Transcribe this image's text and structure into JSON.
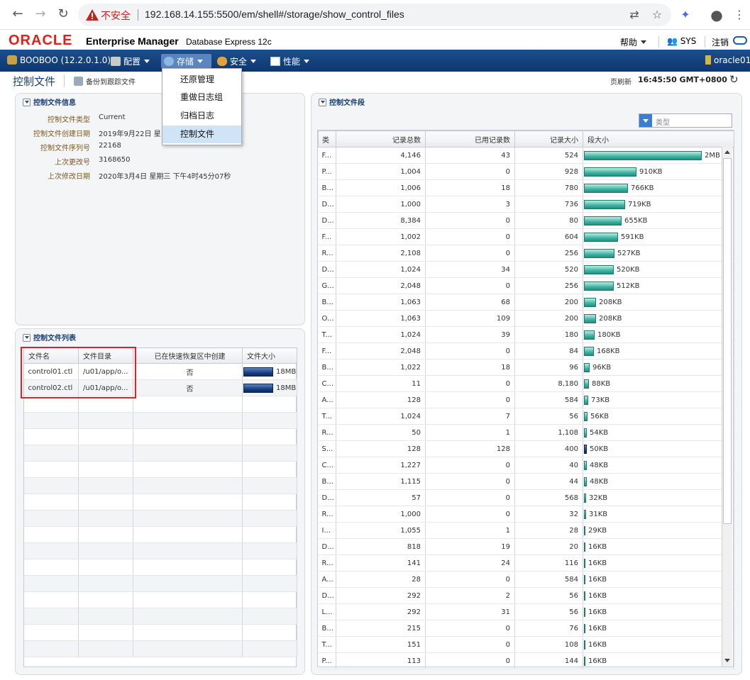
{
  "browser": {
    "not_secure": "不安全",
    "url": "192.168.14.155:5500/em/shell#/storage/show_control_files"
  },
  "header": {
    "logo": "ORACLE",
    "product": "Enterprise Manager",
    "edition": "Database Express 12c",
    "help": "帮助",
    "user": "SYS",
    "logout": "注销"
  },
  "nav": {
    "db": "BOOBOO (12.2.0.1.0)",
    "config": "配置",
    "storage": "存储",
    "security": "安全",
    "performance": "性能",
    "host": "oracle01"
  },
  "storage_menu": [
    "还原管理",
    "重做日志组",
    "归档日志",
    "控制文件"
  ],
  "page": {
    "title": "控制文件",
    "backup_trace": "备份到跟踪文件",
    "refresh_label": "页刷新",
    "refresh_time": "16:45:50 GMT+0800"
  },
  "info_panel": {
    "title": "控制文件信息",
    "rows": [
      {
        "label": "控制文件类型",
        "value": "Current"
      },
      {
        "label": "控制文件创建日期",
        "value": "2019年9月22日 星"
      },
      {
        "label": "控制文件序列号",
        "value": "22168"
      },
      {
        "label": "上次更改号",
        "value": "3168650"
      },
      {
        "label": "上次修改日期",
        "value": "2020年3月4日 星期三 下午4时45分07秒"
      }
    ]
  },
  "files_panel": {
    "title": "控制文件列表",
    "columns": [
      "文件名",
      "文件目录",
      "已在快速恢复区中创建",
      "文件大小"
    ],
    "rows": [
      {
        "name": "control01.ctl",
        "dir": "/u01/app/o...",
        "fra": "否",
        "size": "18MB"
      },
      {
        "name": "control02.ctl",
        "dir": "/u01/app/o...",
        "fra": "否",
        "size": "18MB"
      }
    ]
  },
  "sections_panel": {
    "title": "控制文件段",
    "filter_placeholder": "类型",
    "columns": [
      "类",
      "记录总数",
      "已用记录数",
      "记录大小",
      "段大小"
    ],
    "rows": [
      {
        "type": "F...",
        "total": "4,146",
        "used": "43",
        "size": "524",
        "seg": "2MB",
        "kb": 2048
      },
      {
        "type": "P...",
        "total": "1,004",
        "used": "0",
        "size": "928",
        "seg": "910KB",
        "kb": 910
      },
      {
        "type": "B...",
        "total": "1,006",
        "used": "18",
        "size": "780",
        "seg": "766KB",
        "kb": 766
      },
      {
        "type": "D...",
        "total": "1,000",
        "used": "3",
        "size": "736",
        "seg": "719KB",
        "kb": 719
      },
      {
        "type": "D...",
        "total": "8,384",
        "used": "0",
        "size": "80",
        "seg": "655KB",
        "kb": 655
      },
      {
        "type": "F...",
        "total": "1,002",
        "used": "0",
        "size": "604",
        "seg": "591KB",
        "kb": 591
      },
      {
        "type": "R...",
        "total": "2,108",
        "used": "0",
        "size": "256",
        "seg": "527KB",
        "kb": 527
      },
      {
        "type": "D...",
        "total": "1,024",
        "used": "34",
        "size": "520",
        "seg": "520KB",
        "kb": 520
      },
      {
        "type": "G...",
        "total": "2,048",
        "used": "0",
        "size": "256",
        "seg": "512KB",
        "kb": 512
      },
      {
        "type": "B...",
        "total": "1,063",
        "used": "68",
        "size": "200",
        "seg": "208KB",
        "kb": 208
      },
      {
        "type": "O...",
        "total": "1,063",
        "used": "109",
        "size": "200",
        "seg": "208KB",
        "kb": 208
      },
      {
        "type": "T...",
        "total": "1,024",
        "used": "39",
        "size": "180",
        "seg": "180KB",
        "kb": 180
      },
      {
        "type": "F...",
        "total": "2,048",
        "used": "0",
        "size": "84",
        "seg": "168KB",
        "kb": 168
      },
      {
        "type": "B...",
        "total": "1,022",
        "used": "18",
        "size": "96",
        "seg": "96KB",
        "kb": 96
      },
      {
        "type": "C...",
        "total": "11",
        "used": "0",
        "size": "8,180",
        "seg": "88KB",
        "kb": 88
      },
      {
        "type": "A...",
        "total": "128",
        "used": "0",
        "size": "584",
        "seg": "73KB",
        "kb": 73
      },
      {
        "type": "T...",
        "total": "1,024",
        "used": "7",
        "size": "56",
        "seg": "56KB",
        "kb": 56
      },
      {
        "type": "R...",
        "total": "50",
        "used": "1",
        "size": "1,108",
        "seg": "54KB",
        "kb": 54
      },
      {
        "type": "S...",
        "total": "128",
        "used": "128",
        "size": "400",
        "seg": "50KB",
        "kb": 50,
        "full": true
      },
      {
        "type": "C...",
        "total": "1,227",
        "used": "0",
        "size": "40",
        "seg": "48KB",
        "kb": 48
      },
      {
        "type": "B...",
        "total": "1,115",
        "used": "0",
        "size": "44",
        "seg": "48KB",
        "kb": 48
      },
      {
        "type": "D...",
        "total": "57",
        "used": "0",
        "size": "568",
        "seg": "32KB",
        "kb": 32
      },
      {
        "type": "R...",
        "total": "1,000",
        "used": "0",
        "size": "32",
        "seg": "31KB",
        "kb": 31
      },
      {
        "type": "I...",
        "total": "1,055",
        "used": "1",
        "size": "28",
        "seg": "29KB",
        "kb": 29
      },
      {
        "type": "D...",
        "total": "818",
        "used": "19",
        "size": "20",
        "seg": "16KB",
        "kb": 16
      },
      {
        "type": "R...",
        "total": "141",
        "used": "24",
        "size": "116",
        "seg": "16KB",
        "kb": 16
      },
      {
        "type": "A...",
        "total": "28",
        "used": "0",
        "size": "584",
        "seg": "16KB",
        "kb": 16
      },
      {
        "type": "D...",
        "total": "292",
        "used": "2",
        "size": "56",
        "seg": "16KB",
        "kb": 16
      },
      {
        "type": "L...",
        "total": "292",
        "used": "31",
        "size": "56",
        "seg": "16KB",
        "kb": 16
      },
      {
        "type": "B...",
        "total": "215",
        "used": "0",
        "size": "76",
        "seg": "16KB",
        "kb": 16
      },
      {
        "type": "T...",
        "total": "151",
        "used": "0",
        "size": "108",
        "seg": "16KB",
        "kb": 16
      },
      {
        "type": "P...",
        "total": "113",
        "used": "0",
        "size": "144",
        "seg": "16KB",
        "kb": 16
      }
    ]
  }
}
